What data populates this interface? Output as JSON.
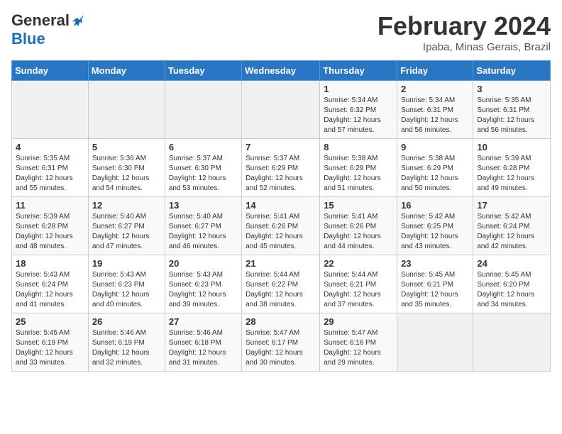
{
  "header": {
    "logo_general": "General",
    "logo_blue": "Blue",
    "month_year": "February 2024",
    "location": "Ipaba, Minas Gerais, Brazil"
  },
  "days_of_week": [
    "Sunday",
    "Monday",
    "Tuesday",
    "Wednesday",
    "Thursday",
    "Friday",
    "Saturday"
  ],
  "weeks": [
    [
      {
        "day": "",
        "info": ""
      },
      {
        "day": "",
        "info": ""
      },
      {
        "day": "",
        "info": ""
      },
      {
        "day": "",
        "info": ""
      },
      {
        "day": "1",
        "info": "Sunrise: 5:34 AM\nSunset: 6:32 PM\nDaylight: 12 hours and 57 minutes."
      },
      {
        "day": "2",
        "info": "Sunrise: 5:34 AM\nSunset: 6:31 PM\nDaylight: 12 hours and 56 minutes."
      },
      {
        "day": "3",
        "info": "Sunrise: 5:35 AM\nSunset: 6:31 PM\nDaylight: 12 hours and 56 minutes."
      }
    ],
    [
      {
        "day": "4",
        "info": "Sunrise: 5:35 AM\nSunset: 6:31 PM\nDaylight: 12 hours and 55 minutes."
      },
      {
        "day": "5",
        "info": "Sunrise: 5:36 AM\nSunset: 6:30 PM\nDaylight: 12 hours and 54 minutes."
      },
      {
        "day": "6",
        "info": "Sunrise: 5:37 AM\nSunset: 6:30 PM\nDaylight: 12 hours and 53 minutes."
      },
      {
        "day": "7",
        "info": "Sunrise: 5:37 AM\nSunset: 6:29 PM\nDaylight: 12 hours and 52 minutes."
      },
      {
        "day": "8",
        "info": "Sunrise: 5:38 AM\nSunset: 6:29 PM\nDaylight: 12 hours and 51 minutes."
      },
      {
        "day": "9",
        "info": "Sunrise: 5:38 AM\nSunset: 6:29 PM\nDaylight: 12 hours and 50 minutes."
      },
      {
        "day": "10",
        "info": "Sunrise: 5:39 AM\nSunset: 6:28 PM\nDaylight: 12 hours and 49 minutes."
      }
    ],
    [
      {
        "day": "11",
        "info": "Sunrise: 5:39 AM\nSunset: 6:28 PM\nDaylight: 12 hours and 48 minutes."
      },
      {
        "day": "12",
        "info": "Sunrise: 5:40 AM\nSunset: 6:27 PM\nDaylight: 12 hours and 47 minutes."
      },
      {
        "day": "13",
        "info": "Sunrise: 5:40 AM\nSunset: 6:27 PM\nDaylight: 12 hours and 46 minutes."
      },
      {
        "day": "14",
        "info": "Sunrise: 5:41 AM\nSunset: 6:26 PM\nDaylight: 12 hours and 45 minutes."
      },
      {
        "day": "15",
        "info": "Sunrise: 5:41 AM\nSunset: 6:26 PM\nDaylight: 12 hours and 44 minutes."
      },
      {
        "day": "16",
        "info": "Sunrise: 5:42 AM\nSunset: 6:25 PM\nDaylight: 12 hours and 43 minutes."
      },
      {
        "day": "17",
        "info": "Sunrise: 5:42 AM\nSunset: 6:24 PM\nDaylight: 12 hours and 42 minutes."
      }
    ],
    [
      {
        "day": "18",
        "info": "Sunrise: 5:43 AM\nSunset: 6:24 PM\nDaylight: 12 hours and 41 minutes."
      },
      {
        "day": "19",
        "info": "Sunrise: 5:43 AM\nSunset: 6:23 PM\nDaylight: 12 hours and 40 minutes."
      },
      {
        "day": "20",
        "info": "Sunrise: 5:43 AM\nSunset: 6:23 PM\nDaylight: 12 hours and 39 minutes."
      },
      {
        "day": "21",
        "info": "Sunrise: 5:44 AM\nSunset: 6:22 PM\nDaylight: 12 hours and 38 minutes."
      },
      {
        "day": "22",
        "info": "Sunrise: 5:44 AM\nSunset: 6:21 PM\nDaylight: 12 hours and 37 minutes."
      },
      {
        "day": "23",
        "info": "Sunrise: 5:45 AM\nSunset: 6:21 PM\nDaylight: 12 hours and 35 minutes."
      },
      {
        "day": "24",
        "info": "Sunrise: 5:45 AM\nSunset: 6:20 PM\nDaylight: 12 hours and 34 minutes."
      }
    ],
    [
      {
        "day": "25",
        "info": "Sunrise: 5:45 AM\nSunset: 6:19 PM\nDaylight: 12 hours and 33 minutes."
      },
      {
        "day": "26",
        "info": "Sunrise: 5:46 AM\nSunset: 6:19 PM\nDaylight: 12 hours and 32 minutes."
      },
      {
        "day": "27",
        "info": "Sunrise: 5:46 AM\nSunset: 6:18 PM\nDaylight: 12 hours and 31 minutes."
      },
      {
        "day": "28",
        "info": "Sunrise: 5:47 AM\nSunset: 6:17 PM\nDaylight: 12 hours and 30 minutes."
      },
      {
        "day": "29",
        "info": "Sunrise: 5:47 AM\nSunset: 6:16 PM\nDaylight: 12 hours and 29 minutes."
      },
      {
        "day": "",
        "info": ""
      },
      {
        "day": "",
        "info": ""
      }
    ]
  ]
}
